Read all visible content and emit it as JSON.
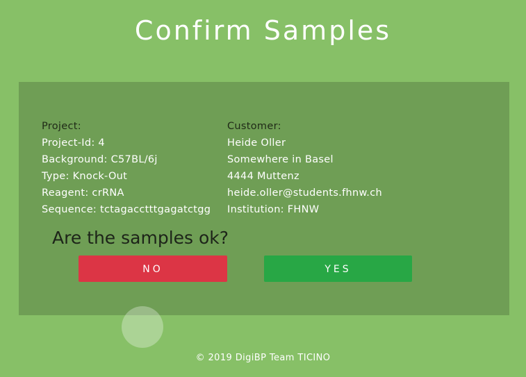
{
  "header": {
    "title": "Confirm Samples"
  },
  "project": {
    "heading": "Project:",
    "id_line": "Project-Id: 4",
    "background_line": "Background: C57BL/6j",
    "type_line": "Type: Knock-Out",
    "reagent_line": "Reagent: crRNA",
    "sequence_line": "Sequence: tctagacctttgagatctgg"
  },
  "customer": {
    "heading": "Customer:",
    "name": "Heide Oller",
    "address": "Somewhere in Basel",
    "city": "4444 Muttenz",
    "email": "heide.oller@students.fhnw.ch",
    "institution_line": "Institution: FHNW"
  },
  "confirm": {
    "question": "Are the samples ok?",
    "no_label": "NO",
    "yes_label": "YES"
  },
  "footer": {
    "text": "© 2019 DigiBP Team TICINO"
  },
  "colors": {
    "background": "#87c067",
    "panel": "#6f9e55",
    "no_button": "#dc3545",
    "yes_button": "#28a745"
  }
}
